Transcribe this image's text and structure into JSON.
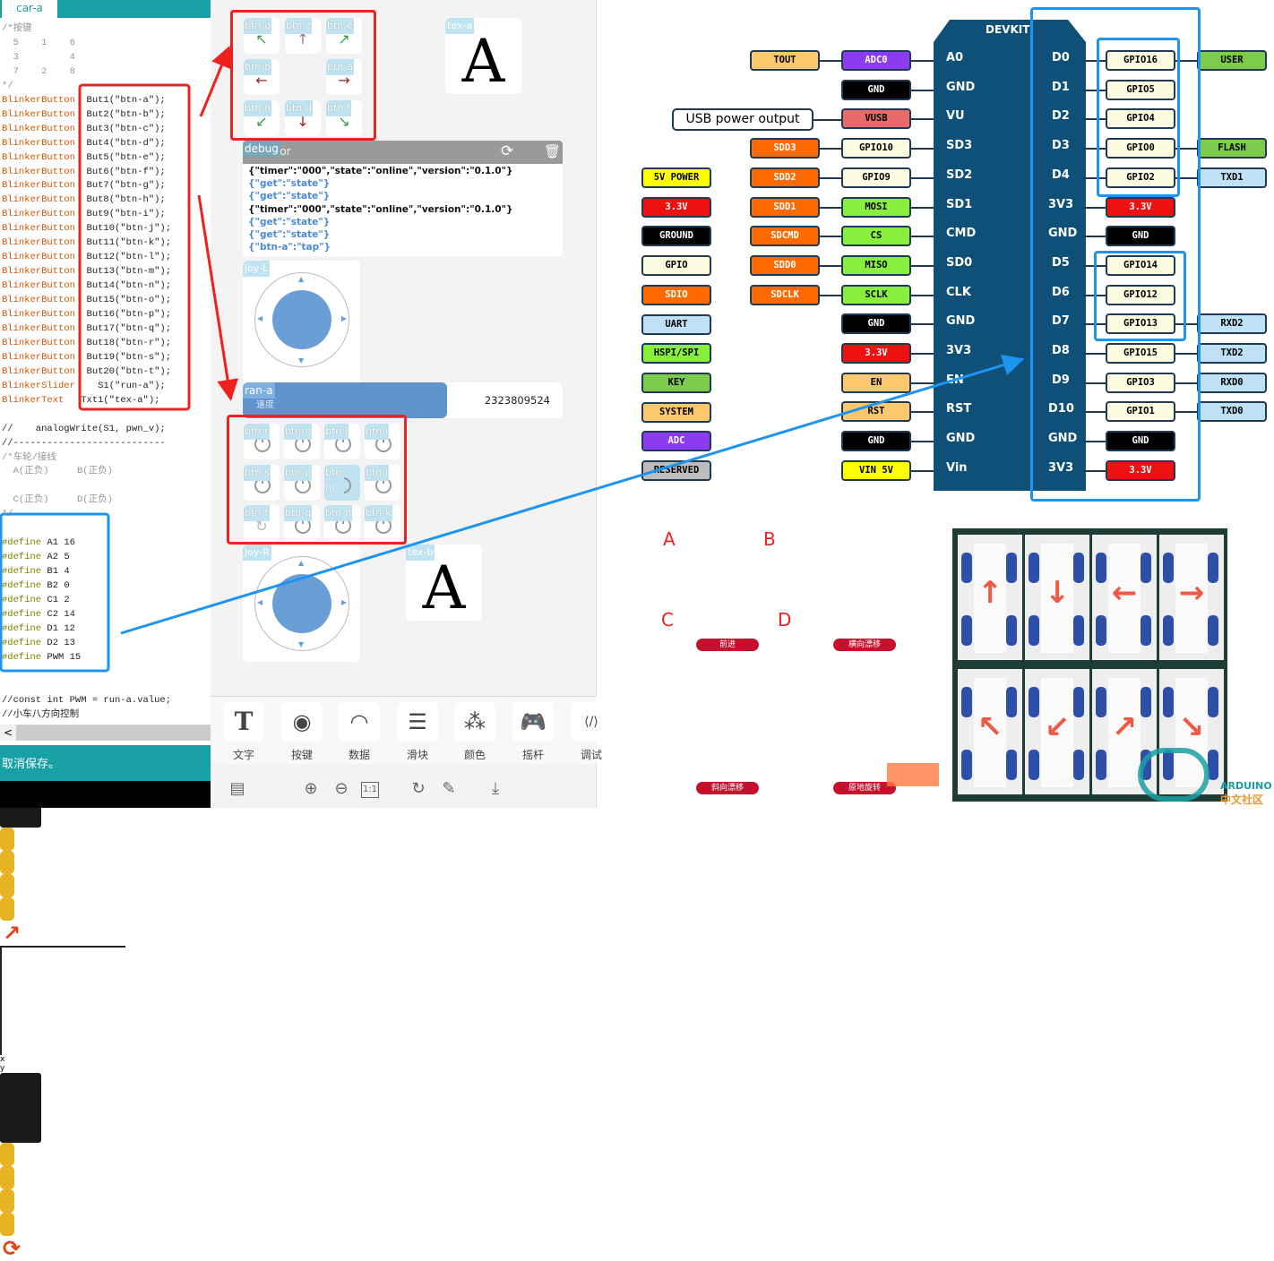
{
  "ide": {
    "tab": "car-a",
    "code_lines": [
      {
        "cls": "cm",
        "kw": "",
        "rest": "/*按键"
      },
      {
        "cls": "cm",
        "kw": "",
        "rest": "  5    1    6"
      },
      {
        "cls": "cm",
        "kw": "",
        "rest": "  3         4"
      },
      {
        "cls": "cm",
        "kw": "",
        "rest": "  7    2    8"
      },
      {
        "cls": "cm",
        "kw": "",
        "rest": "*/"
      },
      {
        "cls": "kw",
        "kw": "BlinkerButton",
        "rest": "  But1(\"btn-a\");"
      },
      {
        "cls": "kw",
        "kw": "BlinkerButton",
        "rest": "  But2(\"btn-b\");"
      },
      {
        "cls": "kw",
        "kw": "BlinkerButton",
        "rest": "  But3(\"btn-c\");"
      },
      {
        "cls": "kw",
        "kw": "BlinkerButton",
        "rest": "  But4(\"btn-d\");"
      },
      {
        "cls": "kw",
        "kw": "BlinkerButton",
        "rest": "  But5(\"btn-e\");"
      },
      {
        "cls": "kw",
        "kw": "BlinkerButton",
        "rest": "  But6(\"btn-f\");"
      },
      {
        "cls": "kw",
        "kw": "BlinkerButton",
        "rest": "  But7(\"btn-g\");"
      },
      {
        "cls": "kw",
        "kw": "BlinkerButton",
        "rest": "  But8(\"btn-h\");"
      },
      {
        "cls": "kw",
        "kw": "BlinkerButton",
        "rest": "  But9(\"btn-i\");"
      },
      {
        "cls": "kw",
        "kw": "BlinkerButton",
        "rest": "  But10(\"btn-j\");"
      },
      {
        "cls": "kw",
        "kw": "BlinkerButton",
        "rest": "  But11(\"btn-k\");"
      },
      {
        "cls": "kw",
        "kw": "BlinkerButton",
        "rest": "  But12(\"btn-l\");"
      },
      {
        "cls": "kw",
        "kw": "BlinkerButton",
        "rest": "  But13(\"btn-m\");"
      },
      {
        "cls": "kw",
        "kw": "BlinkerButton",
        "rest": "  But14(\"btn-n\");"
      },
      {
        "cls": "kw",
        "kw": "BlinkerButton",
        "rest": "  But15(\"btn-o\");"
      },
      {
        "cls": "kw",
        "kw": "BlinkerButton",
        "rest": "  But16(\"btn-p\");"
      },
      {
        "cls": "kw",
        "kw": "BlinkerButton",
        "rest": "  But17(\"btn-q\");"
      },
      {
        "cls": "kw",
        "kw": "BlinkerButton",
        "rest": "  But18(\"btn-r\");"
      },
      {
        "cls": "kw",
        "kw": "BlinkerButton",
        "rest": "  But19(\"btn-s\");"
      },
      {
        "cls": "kw",
        "kw": "BlinkerButton",
        "rest": "  But20(\"btn-t\");"
      },
      {
        "cls": "kw",
        "kw": "BlinkerSlider",
        "rest": "    S1(\"run-a\");"
      },
      {
        "cls": "kw",
        "kw": "BlinkerText",
        "rest": "   Txt1(\"tex-a\");"
      },
      {
        "cls": "",
        "kw": "",
        "rest": ""
      },
      {
        "cls": "",
        "kw": "",
        "rest": "//    analogWrite(S1, pwn_v);"
      },
      {
        "cls": "",
        "kw": "",
        "rest": "//---------------------------"
      },
      {
        "cls": "cm",
        "kw": "",
        "rest": "/*车轮/接线"
      },
      {
        "cls": "cm",
        "kw": "",
        "rest": "  A(正负)     B(正负)"
      },
      {
        "cls": "",
        "kw": "",
        "rest": ""
      },
      {
        "cls": "cm",
        "kw": "",
        "rest": "  C(正负)     D(正负)"
      },
      {
        "cls": "cm",
        "kw": "",
        "rest": "*/"
      },
      {
        "cls": "",
        "kw": "",
        "rest": ""
      },
      {
        "cls": "pp",
        "kw": "#define",
        "rest": " A1 16"
      },
      {
        "cls": "pp",
        "kw": "#define",
        "rest": " A2 5"
      },
      {
        "cls": "pp",
        "kw": "#define",
        "rest": " B1 4"
      },
      {
        "cls": "pp",
        "kw": "#define",
        "rest": " B2 0"
      },
      {
        "cls": "pp",
        "kw": "#define",
        "rest": " C1 2"
      },
      {
        "cls": "pp",
        "kw": "#define",
        "rest": " C2 14"
      },
      {
        "cls": "pp",
        "kw": "#define",
        "rest": " D1 12"
      },
      {
        "cls": "pp",
        "kw": "#define",
        "rest": " D2 13"
      },
      {
        "cls": "pp",
        "kw": "#define",
        "rest": " PWM 15"
      },
      {
        "cls": "",
        "kw": "",
        "rest": ""
      },
      {
        "cls": "",
        "kw": "",
        "rest": ""
      },
      {
        "cls": "",
        "kw": "",
        "rest": "//const int PWM = run-a.value;"
      },
      {
        "cls": "",
        "kw": "",
        "rest": "//小车八方向控制"
      }
    ],
    "scroll_left": "<",
    "status": "取消保存。"
  },
  "blinker": {
    "direction_buttons": [
      {
        "label": "btn-g",
        "icon": "arrow-up-left-icon",
        "glyph": "↖",
        "color": "#3a9a4a"
      },
      {
        "label": "btn-c",
        "icon": "arrow-up-icon",
        "glyph": "↑",
        "color": "#b0707a"
      },
      {
        "label": "btn-e",
        "icon": "arrow-up-right-icon",
        "glyph": "↗",
        "color": "#3a9a4a"
      },
      {
        "label": "btn-b",
        "icon": "arrow-left-icon",
        "glyph": "←",
        "color": "#a02020"
      },
      null,
      {
        "label": "btn-a",
        "icon": "arrow-right-icon",
        "glyph": "→",
        "color": "#a02020"
      },
      {
        "label": "btn-h",
        "icon": "arrow-down-left-icon",
        "glyph": "↙",
        "color": "#3a9a4a"
      },
      {
        "label": "btn-d",
        "icon": "arrow-down-icon",
        "glyph": "↓",
        "color": "#a02020"
      },
      {
        "label": "btn-f",
        "icon": "arrow-down-right-icon",
        "glyph": "↘",
        "color": "#3a9a4a"
      }
    ],
    "text_a": {
      "label": "tex-a",
      "value": "A"
    },
    "debug": {
      "label": "debug",
      "title": "Monitor",
      "lines": [
        {
          "text": "{\"timer\":\"000\",\"state\":\"online\",\"version\":\"0.1.0\"}",
          "color": "#111111"
        },
        {
          "text": "{\"get\":\"state\"}",
          "color": "#4a8ad6"
        },
        {
          "text": "{\"get\":\"state\"}",
          "color": "#4a8ad6"
        },
        {
          "text": "{\"timer\":\"000\",\"state\":\"online\",\"version\":\"0.1.0\"}",
          "color": "#111111"
        },
        {
          "text": "{\"get\":\"state\"}",
          "color": "#4a8ad6"
        },
        {
          "text": "{\"get\":\"state\"}",
          "color": "#4a8ad6"
        },
        {
          "text": "{\"btn-a\":\"tap\"}",
          "color": "#4a8ad6"
        }
      ]
    },
    "joy_l": {
      "label": "joy-L"
    },
    "slider": {
      "label": "ran-a",
      "sublabel": "速度",
      "value": "2323809524",
      "fill_percent": 64
    },
    "power_buttons": [
      {
        "label": "btn-r"
      },
      {
        "label": "btn-o"
      },
      {
        "label": "btn-l"
      },
      {
        "label": "btn-i"
      },
      {
        "label": "btn-s"
      },
      {
        "label": "btn-p"
      },
      {
        "label": "btn-m",
        "active": true
      },
      {
        "label": "btn-j"
      },
      {
        "label": "btn-t",
        "icon": "refresh"
      },
      {
        "label": "btn-q"
      },
      {
        "label": "btn-n"
      },
      {
        "label": "btn-k"
      }
    ],
    "joy_r": {
      "label": "joy-R"
    },
    "text_b": {
      "label": "tex-b",
      "value": "A"
    },
    "widgets": [
      {
        "label": "文字",
        "icon": "text-icon",
        "glyph": "T"
      },
      {
        "label": "按键",
        "icon": "button-icon",
        "glyph": "◉"
      },
      {
        "label": "数据",
        "icon": "gauge-icon",
        "glyph": "◠"
      },
      {
        "label": "滑块",
        "icon": "slider-icon",
        "glyph": "☰"
      },
      {
        "label": "颜色",
        "icon": "color-icon",
        "glyph": "⁂"
      },
      {
        "label": "摇杆",
        "icon": "gamepad-icon",
        "glyph": "🎮"
      },
      {
        "label": "调试",
        "icon": "debug-icon",
        "glyph": "⟨/⟩"
      }
    ],
    "bottom_icons": [
      {
        "name": "layout-icon",
        "glyph": "▤"
      },
      {
        "name": "zoom-in-icon",
        "glyph": "⊕"
      },
      {
        "name": "zoom-out-icon",
        "glyph": "⊖"
      },
      {
        "name": "actual-size-icon",
        "glyph": "1:1"
      },
      {
        "name": "redo-icon",
        "glyph": "↻"
      },
      {
        "name": "edit-icon",
        "glyph": "✎"
      },
      {
        "name": "download-icon",
        "glyph": "⤓"
      }
    ]
  },
  "pinout": {
    "board_title": "DEVKIT",
    "usb_note": "USB power output",
    "legend": [
      {
        "t": "5V POWER",
        "bg": "#ffff00",
        "fg": "#000"
      },
      {
        "t": "3.3V",
        "bg": "#ee1111",
        "fg": "#fff"
      },
      {
        "t": "GROUND",
        "bg": "#000000",
        "fg": "#fff"
      },
      {
        "t": "GPIO",
        "bg": "#fdfbe0",
        "fg": "#000"
      },
      {
        "t": "SDIO",
        "bg": "#ff6a00",
        "fg": "#fff"
      },
      {
        "t": "UART",
        "bg": "#bfe1f5",
        "fg": "#000"
      },
      {
        "t": "HSPI/SPI",
        "bg": "#88f03c",
        "fg": "#000"
      },
      {
        "t": "KEY",
        "bg": "#7ccb4a",
        "fg": "#000"
      },
      {
        "t": "SYSTEM",
        "bg": "#fbc86e",
        "fg": "#000"
      },
      {
        "t": "ADC",
        "bg": "#8b3cf0",
        "fg": "#fff"
      },
      {
        "t": "RESERVED",
        "bg": "#bdbdbd",
        "fg": "#000"
      }
    ],
    "outer_left": [
      {
        "t": "TOUT",
        "bg": "#fbc86e",
        "fg": "#000"
      },
      null,
      null,
      {
        "t": "SDD3",
        "bg": "#ff6a00",
        "fg": "#fff"
      },
      {
        "t": "SDD2",
        "bg": "#ff6a00",
        "fg": "#fff"
      },
      {
        "t": "SDD1",
        "bg": "#ff6a00",
        "fg": "#fff"
      },
      {
        "t": "SDCMD",
        "bg": "#ff6a00",
        "fg": "#fff"
      },
      {
        "t": "SDD0",
        "bg": "#ff6a00",
        "fg": "#fff"
      },
      {
        "t": "SDCLK",
        "bg": "#ff6a00",
        "fg": "#fff"
      }
    ],
    "inner_left": [
      {
        "t": "ADC0",
        "bg": "#8b3cf0",
        "fg": "#fff"
      },
      {
        "t": "GND",
        "bg": "#000000",
        "fg": "#fff"
      },
      {
        "t": "VUSB",
        "bg": "#e86a6a",
        "fg": "#000"
      },
      {
        "t": "GPIO10",
        "bg": "#fdfbe0",
        "fg": "#000"
      },
      {
        "t": "GPIO9",
        "bg": "#fdfbe0",
        "fg": "#000"
      },
      {
        "t": "MOSI",
        "bg": "#88f03c",
        "fg": "#000"
      },
      {
        "t": "CS",
        "bg": "#88f03c",
        "fg": "#000"
      },
      {
        "t": "MISO",
        "bg": "#88f03c",
        "fg": "#000"
      },
      {
        "t": "SCLK",
        "bg": "#88f03c",
        "fg": "#000"
      },
      {
        "t": "GND",
        "bg": "#000000",
        "fg": "#fff"
      },
      {
        "t": "3.3V",
        "bg": "#ee1111",
        "fg": "#fff"
      },
      {
        "t": "EN",
        "bg": "#fbc86e",
        "fg": "#000"
      },
      {
        "t": "RST",
        "bg": "#fbc86e",
        "fg": "#000"
      },
      {
        "t": "GND",
        "bg": "#000000",
        "fg": "#fff"
      },
      {
        "t": "VIN 5V",
        "bg": "#ffff00",
        "fg": "#000"
      }
    ],
    "board_left": [
      "A0",
      "GND",
      "VU",
      "SD3",
      "SD2",
      "SD1",
      "CMD",
      "SD0",
      "CLK",
      "GND",
      "3V3",
      "EN",
      "RST",
      "GND",
      "Vin"
    ],
    "board_right": [
      "D0",
      "D1",
      "D2",
      "D3",
      "D4",
      "3V3",
      "GND",
      "D5",
      "D6",
      "D7",
      "D8",
      "D9",
      "D10",
      "GND",
      "3V3"
    ],
    "inner_right": [
      {
        "t": "GPIO16",
        "bg": "#fdfbe0",
        "fg": "#000"
      },
      {
        "t": "GPIO5",
        "bg": "#fdfbe0",
        "fg": "#000"
      },
      {
        "t": "GPIO4",
        "bg": "#fdfbe0",
        "fg": "#000"
      },
      {
        "t": "GPIO0",
        "bg": "#fdfbe0",
        "fg": "#000"
      },
      {
        "t": "GPIO2",
        "bg": "#fdfbe0",
        "fg": "#000"
      },
      {
        "t": "3.3V",
        "bg": "#ee1111",
        "fg": "#fff"
      },
      {
        "t": "GND",
        "bg": "#000000",
        "fg": "#fff"
      },
      {
        "t": "GPIO14",
        "bg": "#fdfbe0",
        "fg": "#000"
      },
      {
        "t": "GPIO12",
        "bg": "#fdfbe0",
        "fg": "#000"
      },
      {
        "t": "GPIO13",
        "bg": "#fdfbe0",
        "fg": "#000"
      },
      {
        "t": "GPIO15",
        "bg": "#fdfbe0",
        "fg": "#000"
      },
      {
        "t": "GPIO3",
        "bg": "#fdfbe0",
        "fg": "#000"
      },
      {
        "t": "GPIO1",
        "bg": "#fdfbe0",
        "fg": "#000"
      },
      {
        "t": "GND",
        "bg": "#000000",
        "fg": "#fff"
      },
      {
        "t": "3.3V",
        "bg": "#ee1111",
        "fg": "#fff"
      }
    ],
    "outer_right": [
      {
        "t": "USER",
        "bg": "#7ccb4a",
        "fg": "#000"
      },
      null,
      null,
      {
        "t": "FLASH",
        "bg": "#7ccb4a",
        "fg": "#000"
      },
      {
        "t": "TXD1",
        "bg": "#bfe1f5",
        "fg": "#000"
      },
      null,
      null,
      null,
      null,
      {
        "t": "RXD2",
        "bg": "#bfe1f5",
        "fg": "#000"
      },
      {
        "t": "TXD2",
        "bg": "#bfe1f5",
        "fg": "#000"
      },
      {
        "t": "RXD0",
        "bg": "#bfe1f5",
        "fg": "#000"
      },
      {
        "t": "TXD0",
        "bg": "#bfe1f5",
        "fg": "#000"
      }
    ]
  },
  "mecanum": {
    "wheels": {
      "a": "A",
      "b": "B",
      "c": "C",
      "d": "D"
    },
    "axis_x": "x",
    "axis_y": "y",
    "modes": [
      "前进",
      "横向漂移",
      "斜向漂移",
      "原地旋转"
    ],
    "mode_arrows": [
      "↑",
      "→",
      "↗",
      "⟳"
    ]
  },
  "photos": {
    "arrows": [
      "↑",
      "↓",
      "←",
      "→",
      "↖",
      "↙",
      "↗",
      "↘"
    ]
  },
  "logo": {
    "line1": "ARDUINO",
    "line2": "中文社区"
  }
}
